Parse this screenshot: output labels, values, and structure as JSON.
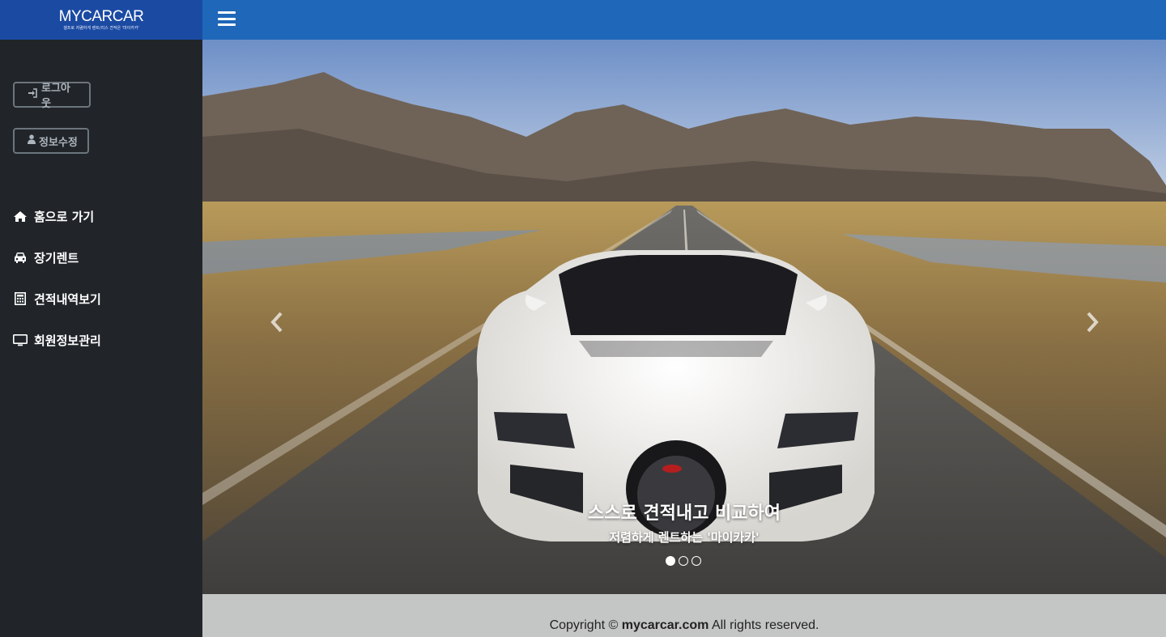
{
  "brand": {
    "logo": "MYCARCAR",
    "tagline": "셀프로 저렴하게 렌트/리스 견적은 '마이카카'"
  },
  "account": {
    "logout_label": "로그아웃",
    "edit_label": "정보수정"
  },
  "nav": {
    "items": [
      {
        "label": "홈으로 가기",
        "icon": "home-icon"
      },
      {
        "label": "장기렌트",
        "icon": "car-icon"
      },
      {
        "label": "견적내역보기",
        "icon": "calculator-icon"
      },
      {
        "label": "회원정보관리",
        "icon": "desktop-icon"
      }
    ]
  },
  "carousel": {
    "caption_title": "스스로 견적내고 비교하여",
    "caption_subtitle": "저렴하게 렌트하는 '마이카카'",
    "slide_count": 3,
    "active_index": 0
  },
  "footer": {
    "prefix": "Copyright ©",
    "domain": "mycarcar.com",
    "suffix": "All rights reserved."
  },
  "colors": {
    "brand_bg": "#1b4aa3",
    "topbar_bg": "#1f67b8",
    "sidebar_bg": "#212529",
    "footer_bg": "#c4c6c5"
  }
}
